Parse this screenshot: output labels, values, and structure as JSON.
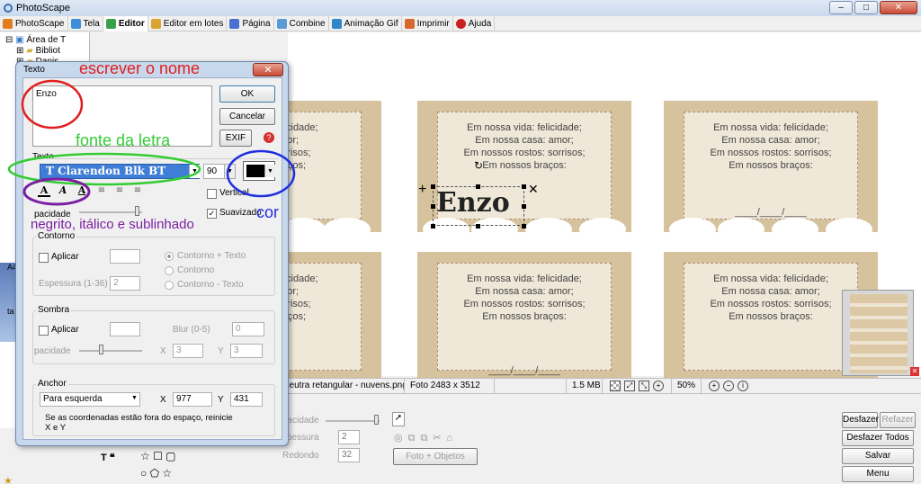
{
  "window": {
    "title": "PhotoScape",
    "min": "–",
    "max": "□",
    "close": "✕"
  },
  "tabs": [
    {
      "label": "PhotoScape",
      "color": "#e07d1f"
    },
    {
      "label": "Tela",
      "color": "#3d8ed9"
    },
    {
      "label": "Editor",
      "color": "#3aa04a"
    },
    {
      "label": "Editor em lotes",
      "color": "#d9a430"
    },
    {
      "label": "Página",
      "color": "#4a6fd0"
    },
    {
      "label": "Combine",
      "color": "#5a9bd5"
    },
    {
      "label": "Animação Gif",
      "color": "#2f86c8"
    },
    {
      "label": "Imprimir",
      "color": "#d9662a"
    },
    {
      "label": "Ajuda",
      "color": "#cc2020"
    }
  ],
  "tree": {
    "items": [
      "Área de T",
      "Bibliot",
      "Danis"
    ],
    "side_labels": [
      "A4",
      "ta"
    ]
  },
  "canvas": {
    "card_lines": [
      "Em nossa vida: felicidade;",
      "Em nossa casa: amor;",
      "Em nossos rostos: sorrisos;",
      "Em nossos braços:"
    ],
    "partial_lines": [
      "felicidade;",
      "amor;",
      "sorrisos;",
      "braços;"
    ],
    "signature": "____/____/____",
    "placed_text": "Enzo"
  },
  "status": {
    "filename": "neutra retangular - nuvens.png",
    "size_label": "Foto 2483 x 3512",
    "filesize": "1.5 MB",
    "zoom": "50%"
  },
  "bottom": {
    "opacity_label": "pacidade",
    "thickness_label": "spessura",
    "thickness_value": "2",
    "round_label": "Redondo",
    "round_value": "32",
    "objects_button": "Foto + Objetos",
    "undo": "Desfazer",
    "redo": "Refazer",
    "undo_all": "Desfazer Todos",
    "save": "Salvar",
    "menu": "Menu"
  },
  "dialog": {
    "title": "Texto",
    "text_value": "Enzo",
    "ok": "OK",
    "cancel": "Cancelar",
    "exif": "EXIF",
    "texto_label": "Texto",
    "font_name": "Clarendon Blk BT",
    "font_size": "90",
    "color": "#000000",
    "vertical_label": "Vertical",
    "smooth_label": "Suavizado",
    "opacity_label": "pacidade",
    "contorno": {
      "title": "Contorno",
      "apply": "Aplicar",
      "thickness": "Espessura (1-36)",
      "value": "2",
      "radio": [
        "Contorno + Texto",
        "Contorno",
        "Contorno - Texto"
      ]
    },
    "sombra": {
      "title": "Sombra",
      "apply": "Aplicar",
      "blur": "Blur (0-5)",
      "blur_value": "0",
      "opacity": "pacidade",
      "x_label": "X",
      "x_value": "3",
      "y_label": "Y",
      "y_value": "3"
    },
    "anchor": {
      "title": "Anchor",
      "select": "Para esquerda",
      "x_label": "X",
      "x_value": "977",
      "y_label": "Y",
      "y_value": "431",
      "note": "Se as coordenadas estão fora do espaço, reinicie X e Y"
    }
  },
  "annotations": {
    "name": "escrever o nome",
    "font": "fonte da letra",
    "color": "cor",
    "style": "negrito, itálico e sublinhado"
  }
}
